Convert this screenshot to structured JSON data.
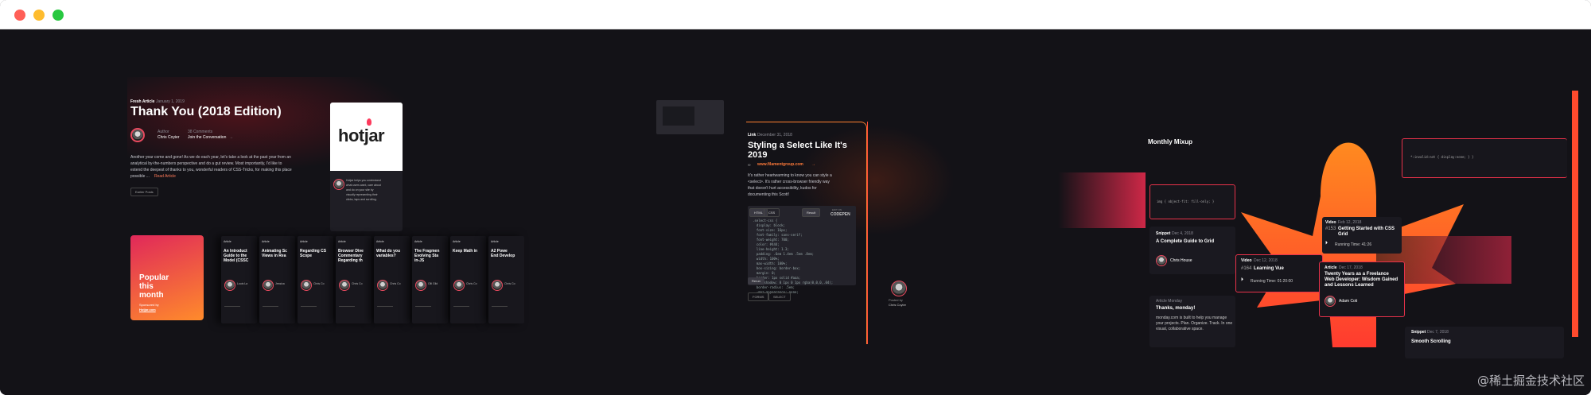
{
  "window": {
    "controls": [
      "close",
      "minimize",
      "maximize"
    ],
    "colors": {
      "close": "#ff5f57",
      "minimize": "#febc2e",
      "maximize": "#28c840"
    }
  },
  "panel1": {
    "eyebrow": "Fresh Article",
    "date": "January 1, 2019",
    "title": "Thank You (2018 Edition)",
    "author_role": "Author",
    "author_name": "Chris Coyier",
    "comments_label": "38 Comments",
    "comments_link": "Join the Conversation",
    "comments_arrow": "→",
    "excerpt_1": "Another year come and gone! As we do each year, let's take a look at the past year from an",
    "excerpt_2": "analytical by-the-numbers perspective and do a gut review. Most importantly, I'd like to",
    "excerpt_3": "extend the deepest of thanks to you, wonderful readers of CSS-Tricks, for making this place",
    "excerpt_4": "possible ...",
    "read_more": "Read Article",
    "button": "Earlier Posts",
    "sponsor_logo": "hotjar",
    "sponsor_text_1": "Hotjar helps you understand",
    "sponsor_text_2": "what users want, care about",
    "sponsor_text_3": "and do on your site by",
    "sponsor_text_4": "visually representing their",
    "sponsor_text_5": "clicks, taps and scrolling."
  },
  "popular": {
    "title_1": "Popular",
    "title_2": "this",
    "title_3": "month",
    "sponsor": "Sponsored by",
    "sponsor_name": "Hotjar.com",
    "cards": [
      {
        "tag": "Article",
        "title_1": "An Introduct",
        "title_2": "Guide to the",
        "title_3": "Model (CSSC",
        "author": "Louis La"
      },
      {
        "tag": "Article",
        "title_1": "Animating Sc",
        "title_2": "Views in Rea",
        "title_3": "",
        "author": "Jessica"
      },
      {
        "tag": "Article",
        "title_1": "Regarding CS",
        "title_2": "Scope",
        "title_3": "",
        "author": "Chris Co"
      },
      {
        "tag": "Article",
        "title_1": "Browser Dive",
        "title_2": "Commentary",
        "title_3": "Regarding th",
        "author": "Chris Co"
      },
      {
        "tag": "Article",
        "title_1": "What do you",
        "title_2": "variables?",
        "title_3": "",
        "author": "Chris Co"
      },
      {
        "tag": "Article",
        "title_1": "The Fragmen",
        "title_2": "Evolving Sta",
        "title_3": "in-JS",
        "author": "Olli Gild"
      },
      {
        "tag": "Article",
        "title_1": "Keep Math in",
        "title_2": "",
        "title_3": "",
        "author": "Chris Co"
      },
      {
        "tag": "Article",
        "title_1": "A2 Powe",
        "title_2": "End Develop",
        "title_3": "",
        "author": "Chris Co"
      }
    ]
  },
  "panel2": {
    "eyebrow": "Link",
    "date": "December 31, 2018",
    "title_1": "Styling a Select Like It's",
    "title_2": "2019",
    "link": "www.filamentgroup.com",
    "link_arrow": "→",
    "body_1": "It's rather heartwarming to know you can style a",
    "body_2": "<select>. It's rather cross-browser friendly way",
    "body_3": "that doesn't hurt accessibility, kudos for",
    "body_4": "documenting this Scott!",
    "tabs": [
      "HTML",
      "CSS"
    ],
    "result_button": "Result",
    "edit_label": "EDIT ON",
    "codepen": "CODEPEN",
    "tags": [
      "FORMS",
      "SELECT"
    ],
    "footer": "Rerun",
    "posted_by": "Posted by",
    "poster": "Chris Coyier",
    "code": [
      ".select-css {",
      "  display: block;",
      "  font-size: 16px;",
      "  font-family: sans-serif;",
      "  font-weight: 700;",
      "  color: #444;",
      "  line-height: 1.3;",
      "  padding: .6em 1.4em .5em .8em;",
      "  width: 100%;",
      "  max-width: 100%;",
      "  box-sizing: border-box;",
      "  margin: 0;",
      "  border: 1px solid #aaa;",
      "  box-shadow: 0 1px 0 1px rgba(0,0,0,.04);",
      "  border-radius: .5em;",
      "  -moz-appearance: none;"
    ]
  },
  "panel3": {
    "title": "Monthly Mixup",
    "code_top": "*:invalid:not { display:none; } }",
    "code_mid": "img { object-fit: fill-only; }",
    "snippet1_tag": "Snippet",
    "snippet1_date": "Dec 4, 2018",
    "snippet1_title": "A Complete Guide to Grid",
    "snippet1_author": "Chris House",
    "video1_tag": "Video",
    "video1_date": "Dec 12, 2018",
    "video1_num": "#164",
    "video1_title": "Learning Vue",
    "video1_time": "Running Time: 01:20:00",
    "video2_tag": "Video",
    "video2_date": "Feb 12, 2018",
    "video2_num": "#153",
    "video2_title_1": "Getting Started with CSS",
    "video2_title_2": "Grid",
    "video2_time": "Running Time: 41:26",
    "article_tag": "Article",
    "article_date": "Dec 17, 2018",
    "article_title_1": "Twenty Years as a Freelance",
    "article_title_2": "Web Developer: Wisdom Gained",
    "article_title_3": "and Lessons Learned",
    "article_author": "Adam Coti",
    "thanks_tag": "Article Monday",
    "thanks_title": "Thanks, monday!",
    "thanks_body_1": "monday.com is built to help you manage",
    "thanks_body_2": "your projects. Plan. Organize. Track. In one",
    "thanks_body_3": "visual, collaborative space.",
    "snippet2_tag": "Snippet",
    "snippet2_date": "Dec 7, 2018",
    "snippet2_title": "Smooth Scrolling"
  },
  "watermark": "@稀土掘金技术社区"
}
